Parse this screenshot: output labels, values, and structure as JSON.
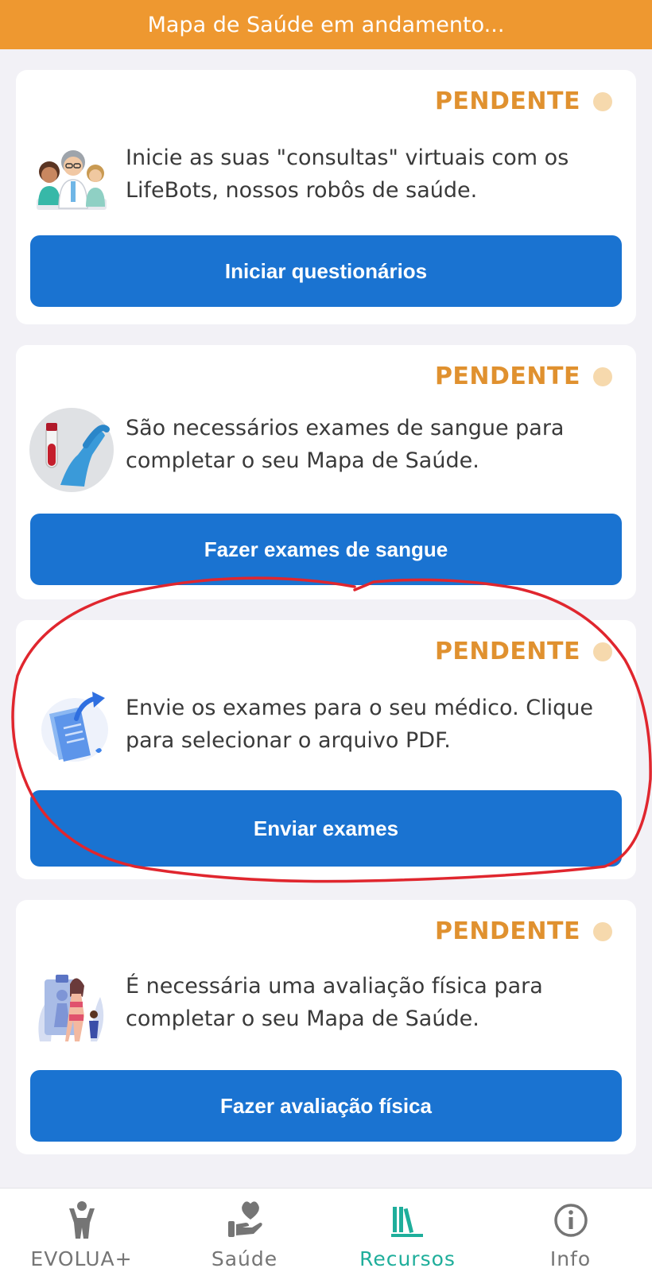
{
  "banner": {
    "text": "Mapa de Saúde em andamento..."
  },
  "cards": [
    {
      "status": "PENDENTE",
      "icon": "doctors-icon",
      "description": "Inicie as suas \"consultas\" virtuais com os LifeBots, nossos robôs de saúde.",
      "button": "Iniciar questionários"
    },
    {
      "status": "PENDENTE",
      "icon": "blood-sample-icon",
      "description": "São necessários exames de sangue para completar o seu Mapa de Saúde.",
      "button": "Fazer exames de sangue"
    },
    {
      "status": "PENDENTE",
      "icon": "send-document-icon",
      "description": "Envie os exames para o seu médico. Clique para selecionar o arquivo PDF.",
      "button": "Enviar exames"
    },
    {
      "status": "PENDENTE",
      "icon": "physical-assessment-icon",
      "description": "É necessária uma avaliação física para completar o seu Mapa de Saúde.",
      "button": "Fazer avaliação física"
    }
  ],
  "nav": {
    "items": [
      {
        "label": "EVOLUA+",
        "icon": "person-icon",
        "active": false
      },
      {
        "label": "Saúde",
        "icon": "heart-hand-icon",
        "active": false
      },
      {
        "label": "Recursos",
        "icon": "books-icon",
        "active": true
      },
      {
        "label": "Info",
        "icon": "info-icon",
        "active": false
      }
    ]
  },
  "colors": {
    "banner": "#ee9830",
    "status": "#e0912f",
    "status_dot": "#f6d9ad",
    "button": "#1a73d1",
    "active_nav": "#1fae9b",
    "annotation": "#e0262e"
  }
}
